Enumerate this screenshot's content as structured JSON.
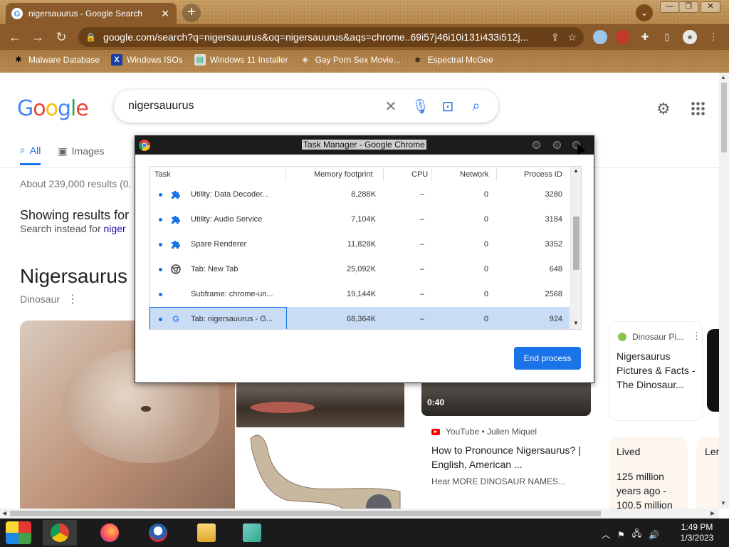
{
  "browser": {
    "tab_title": "nigersauurus - Google Search",
    "tab_close": "✕",
    "new_tab": "+",
    "tab_search": "⌄",
    "window_controls": [
      "—",
      "❐",
      "✕"
    ],
    "url": "google.com/search?q=nigersauurus&oq=nigersauurus&aqs=chrome..69i57j46i10i131i433i512j...",
    "bookmarks": [
      {
        "label": "Malware Database",
        "icon": "bug-icon"
      },
      {
        "label": "Windows ISOs",
        "icon": "x-logo-icon"
      },
      {
        "label": "Windows 11 Installer",
        "icon": "installer-icon"
      },
      {
        "label": "Gay Porn Sex Movie...",
        "icon": "site-icon"
      },
      {
        "label": "Espectral McGee",
        "icon": "avatar-icon"
      }
    ]
  },
  "google": {
    "query": "nigersauurus",
    "tabs": [
      {
        "label": "All",
        "active": true
      },
      {
        "label": "Images",
        "active": false
      }
    ],
    "result_stats": "About 239,000 results (0.",
    "showing_results_for": "Showing results for",
    "search_instead_prefix": "Search instead for",
    "search_instead_link": "niger",
    "kp_title": "Nigersaurus",
    "kp_subtitle": "Dinosaur",
    "video": {
      "duration": "0:40",
      "source": "YouTube • Julien Miquel",
      "title": "How to Pronounce Nigersaurus? | English, American ...",
      "description": "Hear MORE DINOSAUR NAMES..."
    },
    "side_card": {
      "source": "Dinosaur Pi...",
      "title": "Nigersaurus Pictures & Facts - The Dinosaur..."
    },
    "facts": [
      {
        "label": "Lived",
        "value": "125 million years ago - 100.5 million"
      },
      {
        "label": "Len",
        "value": ""
      }
    ]
  },
  "task_manager": {
    "title": "Task Manager - Google Chrome",
    "columns": [
      "Task",
      "Memory footprint",
      "CPU",
      "Network",
      "Process ID"
    ],
    "rows": [
      {
        "task": "Utility: Data Decoder...",
        "icon": "puzzle-icon",
        "memory": "8,288K",
        "cpu": "–",
        "network": "0",
        "pid": "3280"
      },
      {
        "task": "Utility: Audio Service",
        "icon": "puzzle-icon",
        "memory": "7,104K",
        "cpu": "–",
        "network": "0",
        "pid": "3184"
      },
      {
        "task": "Spare Renderer",
        "icon": "puzzle-icon",
        "memory": "11,828K",
        "cpu": "–",
        "network": "0",
        "pid": "3352"
      },
      {
        "task": "Tab: New Tab",
        "icon": "chrome-icon",
        "memory": "25,092K",
        "cpu": "–",
        "network": "0",
        "pid": "648"
      },
      {
        "task": "Subframe: chrome-un...",
        "icon": "",
        "memory": "19,144K",
        "cpu": "–",
        "network": "0",
        "pid": "2568"
      },
      {
        "task": "Tab: nigersauurus - G...",
        "icon": "google-icon",
        "memory": "68,364K",
        "cpu": "–",
        "network": "0",
        "pid": "924",
        "selected": true
      }
    ],
    "end_process_label": "End process"
  },
  "taskbar": {
    "time": "1:49 PM",
    "date": "1/3/2023",
    "apps": [
      "chrome-icon",
      "firefox-icon",
      "obama-logo-icon",
      "file-explorer-icon",
      "network-icon"
    ]
  },
  "colors": {
    "google_blue": "#1a73e8",
    "chrome_frame": "#8a5a2a",
    "selection": "#c9dcf5"
  }
}
